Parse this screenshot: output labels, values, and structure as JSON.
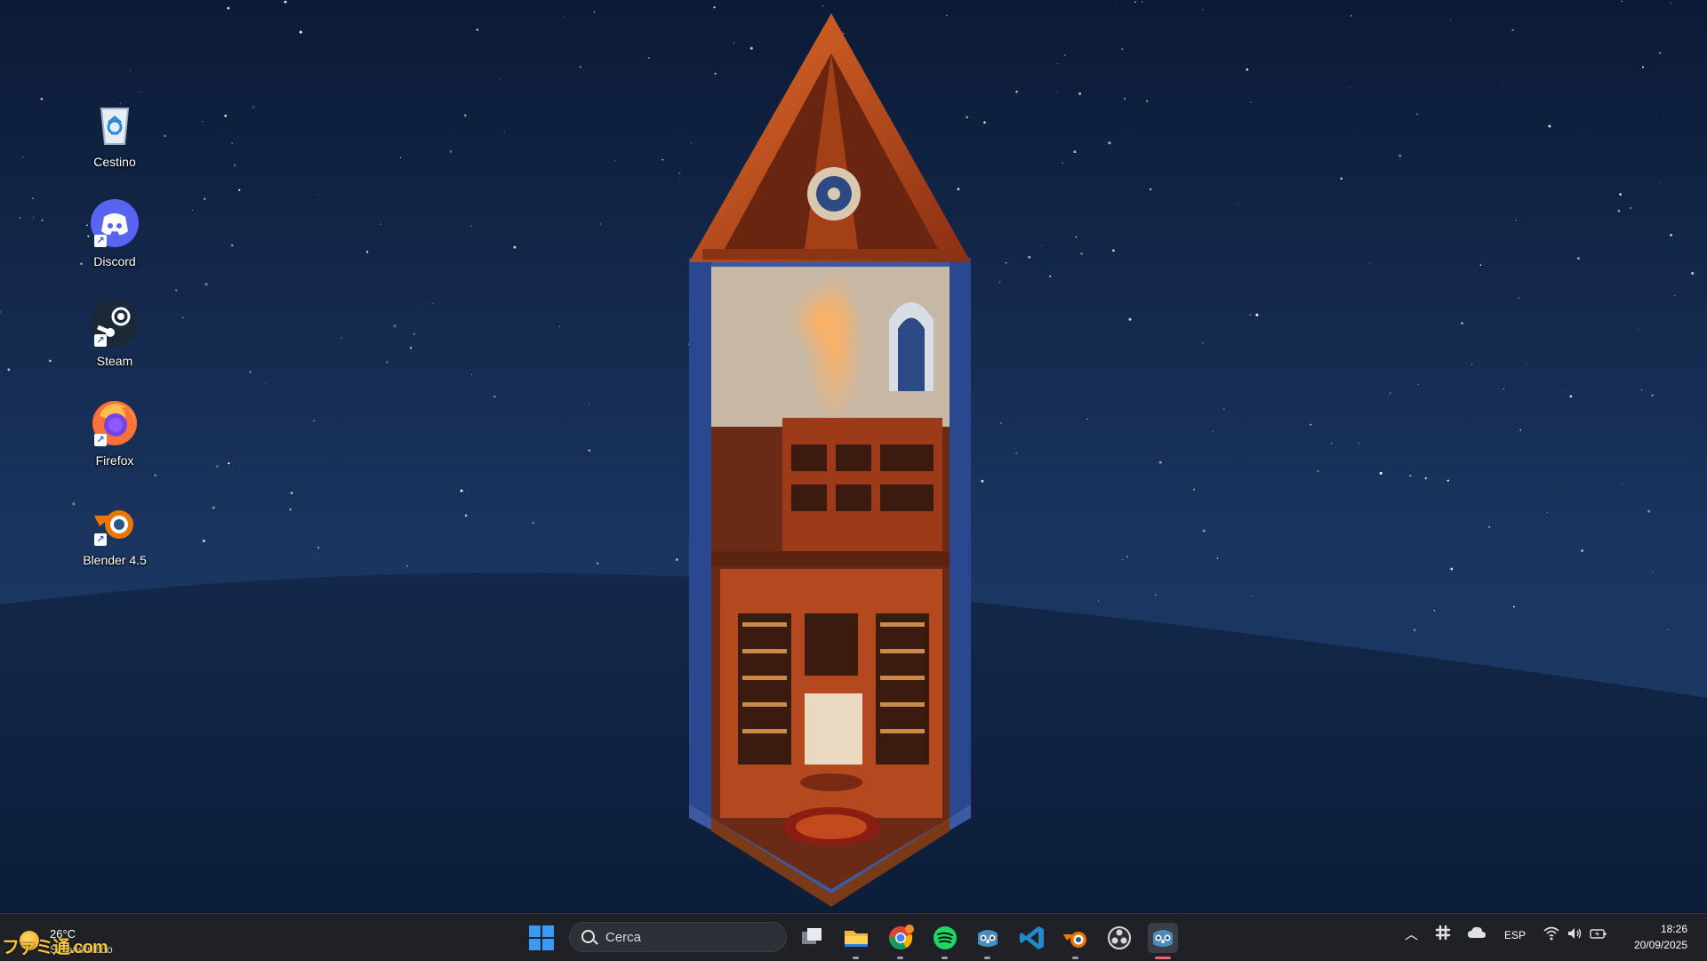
{
  "desktop": {
    "icons": [
      {
        "label": "Cestino",
        "icon": "recycle-bin-icon"
      },
      {
        "label": "Discord",
        "icon": "discord-icon"
      },
      {
        "label": "Steam",
        "icon": "steam-icon"
      },
      {
        "label": "Firefox",
        "icon": "firefox-icon"
      },
      {
        "label": "Blender 4.5",
        "icon": "blender-icon"
      }
    ],
    "wallpaper": "night-sky-tower-library"
  },
  "taskbar": {
    "weather": {
      "temp": "26°C",
      "condition": "Sereno/nitido"
    },
    "search_placeholder": "Cerca",
    "apps": [
      {
        "name": "task-view",
        "icon": "task-view-icon"
      },
      {
        "name": "file-explorer",
        "icon": "folder-icon"
      },
      {
        "name": "chrome",
        "icon": "chrome-icon"
      },
      {
        "name": "spotify",
        "icon": "spotify-icon"
      },
      {
        "name": "godot",
        "icon": "godot-icon"
      },
      {
        "name": "vscode",
        "icon": "vscode-icon"
      },
      {
        "name": "blender",
        "icon": "blender-icon"
      },
      {
        "name": "obs",
        "icon": "obs-icon"
      },
      {
        "name": "godot-active",
        "icon": "godot-icon"
      }
    ],
    "tray": {
      "language": "ESP",
      "time": "18:26",
      "date": "20/09/2025"
    }
  },
  "colors": {
    "taskbar_bg": "#1f2126",
    "accent": "#3a9bf4",
    "active_indicator": "#f0637b"
  },
  "watermark": "ファミ通.com"
}
